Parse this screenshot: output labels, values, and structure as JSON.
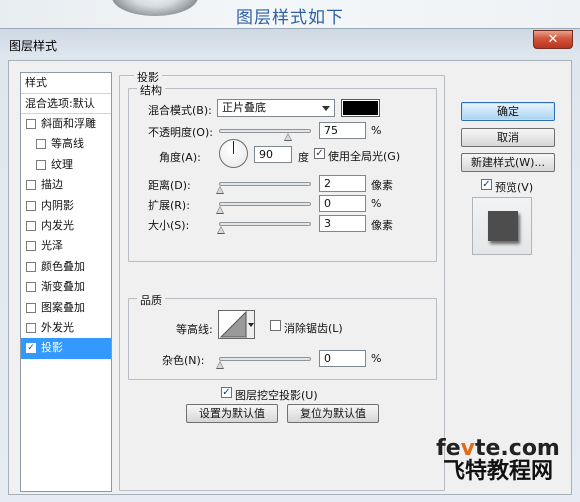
{
  "banner": {
    "title": "图层样式如下"
  },
  "window": {
    "title": "图层样式",
    "close_glyph": "✕"
  },
  "styles_panel": {
    "header": "样式",
    "blend_options": "混合选项:默认",
    "items": [
      {
        "label": "斜面和浮雕",
        "checked": false,
        "indent": false,
        "active": false
      },
      {
        "label": "等高线",
        "checked": false,
        "indent": true,
        "active": false
      },
      {
        "label": "纹理",
        "checked": false,
        "indent": true,
        "active": false
      },
      {
        "label": "描边",
        "checked": false,
        "indent": false,
        "active": false
      },
      {
        "label": "内阴影",
        "checked": false,
        "indent": false,
        "active": false
      },
      {
        "label": "内发光",
        "checked": false,
        "indent": false,
        "active": false
      },
      {
        "label": "光泽",
        "checked": false,
        "indent": false,
        "active": false
      },
      {
        "label": "颜色叠加",
        "checked": false,
        "indent": false,
        "active": false
      },
      {
        "label": "渐变叠加",
        "checked": false,
        "indent": false,
        "active": false
      },
      {
        "label": "图案叠加",
        "checked": false,
        "indent": false,
        "active": false
      },
      {
        "label": "外发光",
        "checked": false,
        "indent": false,
        "active": false
      },
      {
        "label": "投影",
        "checked": true,
        "indent": false,
        "active": true
      }
    ]
  },
  "drop_shadow": {
    "title": "投影",
    "structure": {
      "title": "结构",
      "blend_mode_label": "混合模式(B):",
      "blend_mode_value": "正片叠底",
      "blend_color": "#000000",
      "opacity_label": "不透明度(O):",
      "opacity_value": "75",
      "opacity_unit": "%",
      "opacity_fraction": 0.75,
      "angle_label": "角度(A):",
      "angle_value": "90",
      "angle_unit": "度",
      "global_light_label": "使用全局光(G)",
      "global_light_checked": true,
      "distance_label": "距离(D):",
      "distance_value": "2",
      "distance_unit": "像素",
      "spread_label": "扩展(R):",
      "spread_value": "0",
      "spread_unit": "%",
      "size_label": "大小(S):",
      "size_value": "3",
      "size_unit": "像素"
    },
    "quality": {
      "title": "品质",
      "contour_label": "等高线:",
      "anti_alias_label": "消除锯齿(L)",
      "anti_alias_checked": false,
      "noise_label": "杂色(N):",
      "noise_value": "0",
      "noise_unit": "%"
    },
    "knockout_label": "图层挖空投影(U)",
    "knockout_checked": true,
    "set_default_label": "设置为默认值",
    "reset_default_label": "复位为默认值"
  },
  "actions": {
    "ok": "确定",
    "cancel": "取消",
    "new_style": "新建样式(W)...",
    "preview_label": "预览(V)",
    "preview_checked": true
  },
  "watermark": {
    "top_a": "fe",
    "top_o": "v",
    "top_b": "te.com",
    "bottom": "飞特教程网"
  }
}
